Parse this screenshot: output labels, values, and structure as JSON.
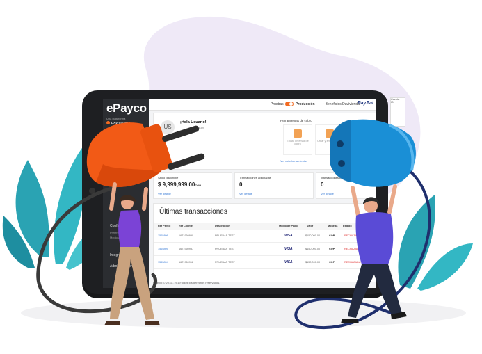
{
  "app": {
    "logo": "ePayco",
    "logo_sub": "Una plataforma",
    "logo_brand": "DAVIVIENDA"
  },
  "sidebar": {
    "items": [
      {
        "label": "Configuración"
      },
      {
        "label": "Integraciones"
      },
      {
        "label": "Administración"
      }
    ],
    "subitems": [
      {
        "label": "Preferencias"
      },
      {
        "label": "Medios de pago"
      }
    ]
  },
  "topbar": {
    "env_test": "Pruebas",
    "env_prod": "Producción",
    "benefits": "Beneficios Davivienda",
    "paypal": "PayPal"
  },
  "user": {
    "avatar": "US",
    "greeting": "¡Hola Usuario!",
    "level": "Premium"
  },
  "tools": {
    "title": "Herramientas de cobro",
    "items": [
      {
        "label": "Enviar un email de cobro"
      },
      {
        "label": "Crear y enviar un link"
      }
    ],
    "more": "Ver más herramientas"
  },
  "balances": [
    {
      "label": "Saldo disponible",
      "value": "$ 9,999,999.00",
      "currency": "COP",
      "link": "Ver detalle"
    },
    {
      "label": "Transacciones aprobadas",
      "value": "0",
      "currency": "",
      "link": "Ver detalle"
    },
    {
      "label": "Transacciones pendientes",
      "value": "0",
      "currency": "",
      "link": "Ver detalle"
    }
  ],
  "transactions": {
    "title": "Últimas transacciones",
    "columns": [
      "Ref Payco",
      "Ref Cliente",
      "Descripción",
      "Medio de Pago",
      "Valor",
      "Moneda",
      "Estado"
    ],
    "rows": [
      {
        "ref": "1565896",
        "client": "1671960990",
        "desc": "PRUEBAS TEST",
        "method": "VISA",
        "value": "$150,000.00",
        "currency": "COP",
        "state": "RECHAZADA"
      },
      {
        "ref": "1565895",
        "client": "1671960937",
        "desc": "PRUEBAS TEST",
        "method": "VISA",
        "value": "$150,000.00",
        "currency": "COP",
        "state": "RECHAZADA"
      },
      {
        "ref": "1565894",
        "client": "1671960912",
        "desc": "PRUEBAS TEST",
        "method": "VISA",
        "value": "$150,000.00",
        "currency": "COP",
        "state": "RECHAZADA"
      }
    ]
  },
  "footer": "ePayco © 2011 - 2019 todos los derechos reservados.",
  "side_panel": {
    "line1": "Cuenta",
    "line2": "ID"
  },
  "colors": {
    "brand_orange": "#f26a21",
    "plug_blue": "#1a8fd6",
    "tablet": "#1e1f22",
    "blob": "#efe9f7",
    "leaves": "#3bb4c1"
  },
  "icons": [
    "orange-plug-icon",
    "blue-plug-icon",
    "leaf-icon"
  ]
}
